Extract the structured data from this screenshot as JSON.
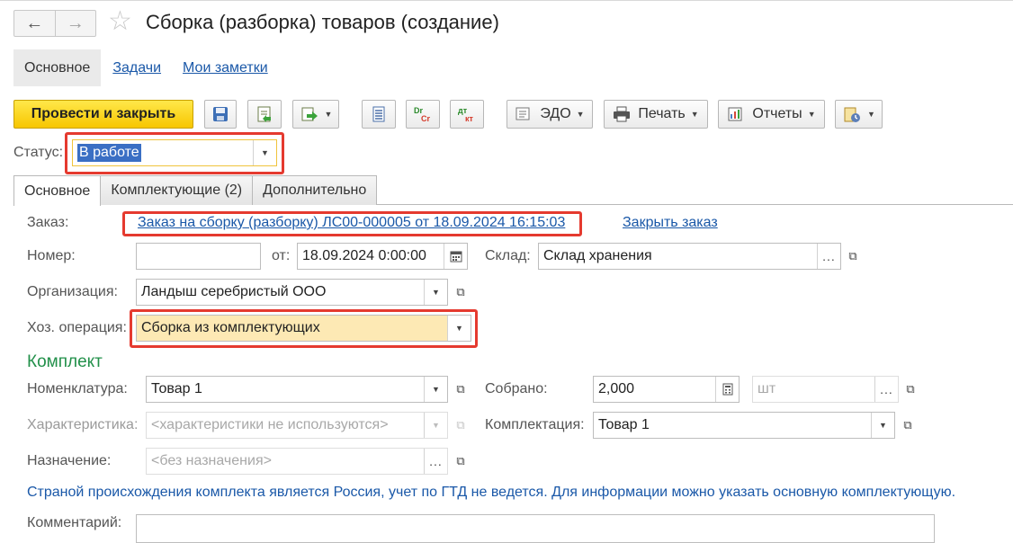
{
  "window": {
    "title": "Сборка (разборка) товаров (создание)",
    "nav_back": "←",
    "nav_forward": "→",
    "favorite_icon": "star-icon"
  },
  "section_tabs": [
    "Основное",
    "Задачи",
    "Мои заметки"
  ],
  "toolbar": {
    "post_close": "Провести и закрыть",
    "edo": "ЭДО",
    "print": "Печать",
    "reports": "Отчеты"
  },
  "status": {
    "label": "Статус:",
    "value": "В работе"
  },
  "inner_tabs": [
    "Основное",
    "Комплектующие (2)",
    "Дополнительно"
  ],
  "form": {
    "order_label": "Заказ:",
    "order_link": "Заказ на сборку (разборку) ЛС00-000005 от 18.09.2024 16:15:03",
    "close_order": "Закрыть заказ",
    "number_label": "Номер:",
    "number_value": "",
    "date_label": "от:",
    "date_value": "18.09.2024  0:00:00",
    "warehouse_label": "Склад:",
    "warehouse_value": "Склад хранения",
    "org_label": "Организация:",
    "org_value": "Ландыш серебристый ООО",
    "operation_label": "Хоз. операция:",
    "operation_value": "Сборка из комплектующих"
  },
  "kit": {
    "heading": "Комплект",
    "nomenclature_label": "Номенклатура:",
    "nomenclature_value": "Товар 1",
    "assembled_label": "Собрано:",
    "assembled_value": "2,000",
    "unit_placeholder": "шт",
    "characteristic_label": "Характеристика:",
    "characteristic_value": "<характеристики не используются>",
    "complectation_label": "Комплектация:",
    "complectation_value": "Товар 1",
    "purpose_label": "Назначение:",
    "purpose_value": "<без назначения>",
    "info_text": "Страной происхождения комплекта является Россия, учет по ГТД не ведется. Для информации можно указать основную комплектующую.",
    "comment_label": "Комментарий:",
    "comment_value": ""
  },
  "colors": {
    "primary_button": "#f7c600",
    "highlight": "#e53a2f",
    "link": "#1a58a8",
    "section_heading": "#22904a",
    "operation_bg": "#fde9b4",
    "status_selection": "#3a6fc4"
  }
}
